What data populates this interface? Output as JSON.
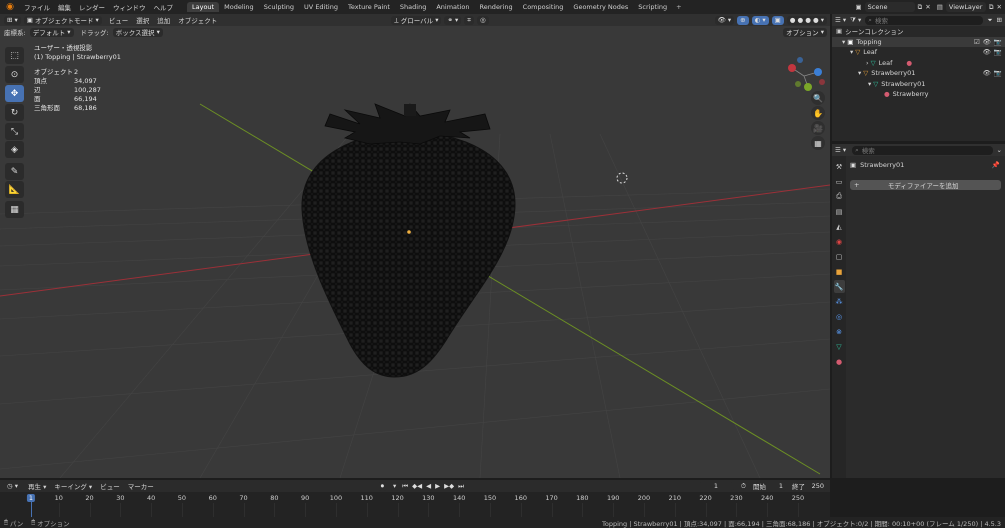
{
  "menu": [
    "ファイル",
    "編集",
    "レンダー",
    "ウィンドウ",
    "ヘルプ"
  ],
  "workspaces": [
    "Layout",
    "Modeling",
    "Sculpting",
    "UV Editing",
    "Texture Paint",
    "Shading",
    "Animation",
    "Rendering",
    "Compositing",
    "Geometry Nodes",
    "Scripting"
  ],
  "active_workspace": "Layout",
  "add_workspace": "+",
  "scene": {
    "label": "Scene",
    "view_layer": "ViewLayer"
  },
  "viewport": {
    "mode": "オブジェクトモード",
    "menus": [
      "ビュー",
      "選択",
      "追加",
      "オブジェクト"
    ],
    "transform": "グローバル",
    "orientation_label": "座標系:",
    "orientation_value": "デフォルト",
    "drag_label": "ドラッグ:",
    "drag_value": "ボックス選択",
    "options": "オプション",
    "view_name": "ユーザー・透視投影",
    "object_context": "(1) Topping | Strawberry01",
    "stats": [
      {
        "k": "オブジェクト",
        "v": "2"
      },
      {
        "k": "頂点",
        "v": "34,097"
      },
      {
        "k": "辺",
        "v": "100,287"
      },
      {
        "k": "面",
        "v": "66,194"
      },
      {
        "k": "三角形面",
        "v": "68,186"
      }
    ],
    "gizmo": {
      "x": "X",
      "y": "Y",
      "z": "Z"
    }
  },
  "outliner": {
    "search_placeholder": "検索",
    "root": "シーンコレクション",
    "rows": [
      {
        "label": "Topping",
        "indent": 1
      },
      {
        "label": "Leaf",
        "indent": 2
      },
      {
        "label": "Leaf",
        "indent": 3
      },
      {
        "label": "Strawberry01",
        "indent": 2
      },
      {
        "label": "Strawberry01",
        "indent": 3
      },
      {
        "label": "Strawberry",
        "indent": 4
      }
    ]
  },
  "properties": {
    "search_placeholder": "検索",
    "object_name": "Strawberry01",
    "add_modifier": "モディファイアーを追加"
  },
  "timeline": {
    "menus": [
      "再生",
      "キーイング",
      "ビュー",
      "マーカー"
    ],
    "current_frame": "1",
    "start_label": "開始",
    "start": "1",
    "end_label": "終了",
    "end": "250",
    "ticks": [
      "1",
      "10",
      "20",
      "30",
      "40",
      "50",
      "60",
      "70",
      "80",
      "90",
      "100",
      "110",
      "120",
      "130",
      "140",
      "150",
      "160",
      "170",
      "180",
      "190",
      "200",
      "210",
      "220",
      "230",
      "240",
      "250"
    ]
  },
  "statusbar": {
    "left1": "パン",
    "left2": "オプション",
    "right": "Topping | Strawberry01 | 頂点:34,097 | 面:66,194 | 三角面:68,186 | オブジェクト:0/2 | 期間: 00:10+00 (フレーム 1/250) | 4.5.3"
  },
  "colors": {
    "accent": "#4772b3",
    "x_axis": "#c2363f",
    "y_axis": "#7ba628",
    "z_axis": "#3b7fd6",
    "blender_orange": "#e87d0d"
  }
}
